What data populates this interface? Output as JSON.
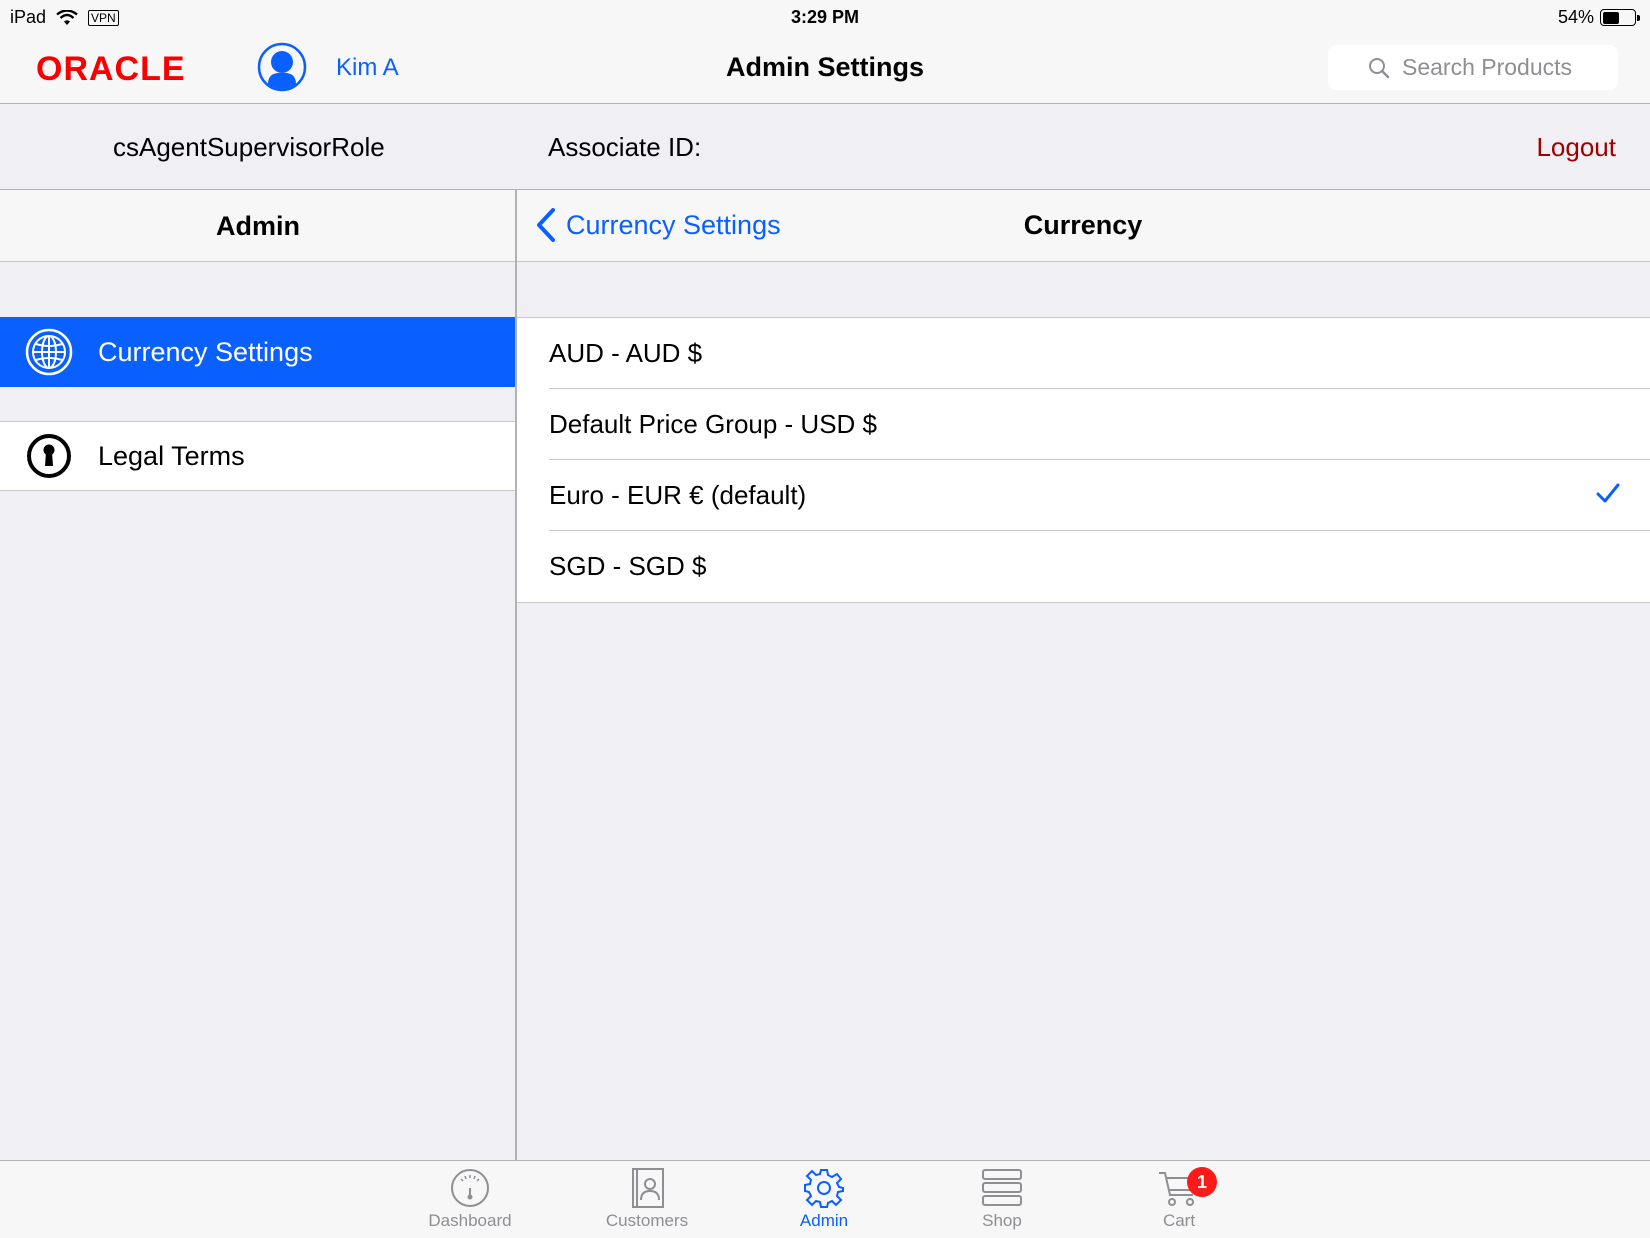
{
  "status_bar": {
    "device": "iPad",
    "vpn": "VPN",
    "time": "3:29 PM",
    "battery_percent": "54%",
    "battery_level": 0.54
  },
  "nav": {
    "logo_text": "ORACLE",
    "user_name": "Kim A",
    "title": "Admin Settings",
    "search_placeholder": "Search Products"
  },
  "info_bar": {
    "role": "csAgentSupervisorRole",
    "associate_label": "Associate ID:",
    "logout_label": "Logout"
  },
  "admin_panel": {
    "title": "Admin",
    "items": [
      {
        "label": "Currency Settings",
        "icon": "globe-icon",
        "selected": true
      },
      {
        "label": "Legal Terms",
        "icon": "keyhole-icon",
        "selected": false
      }
    ]
  },
  "detail_panel": {
    "back_label": "Currency Settings",
    "title": "Currency",
    "currencies": [
      {
        "label": "AUD - AUD $",
        "checked": false
      },
      {
        "label": "Default Price Group - USD $",
        "checked": false
      },
      {
        "label": "Euro - EUR € (default)",
        "checked": true
      },
      {
        "label": "SGD - SGD $",
        "checked": false
      }
    ]
  },
  "tab_bar": {
    "tabs": [
      {
        "label": "Dashboard",
        "icon": "dashboard-gauge-icon",
        "active": false
      },
      {
        "label": "Customers",
        "icon": "contacts-book-icon",
        "active": false
      },
      {
        "label": "Admin",
        "icon": "gear-icon",
        "active": true
      },
      {
        "label": "Shop",
        "icon": "list-stack-icon",
        "active": false
      },
      {
        "label": "Cart",
        "icon": "cart-icon",
        "active": false,
        "badge": "1"
      }
    ]
  },
  "colors": {
    "accent": "#0a60ff",
    "logout": "#a00000",
    "oracle_red": "#f80000",
    "badge": "#ff1a1a"
  }
}
